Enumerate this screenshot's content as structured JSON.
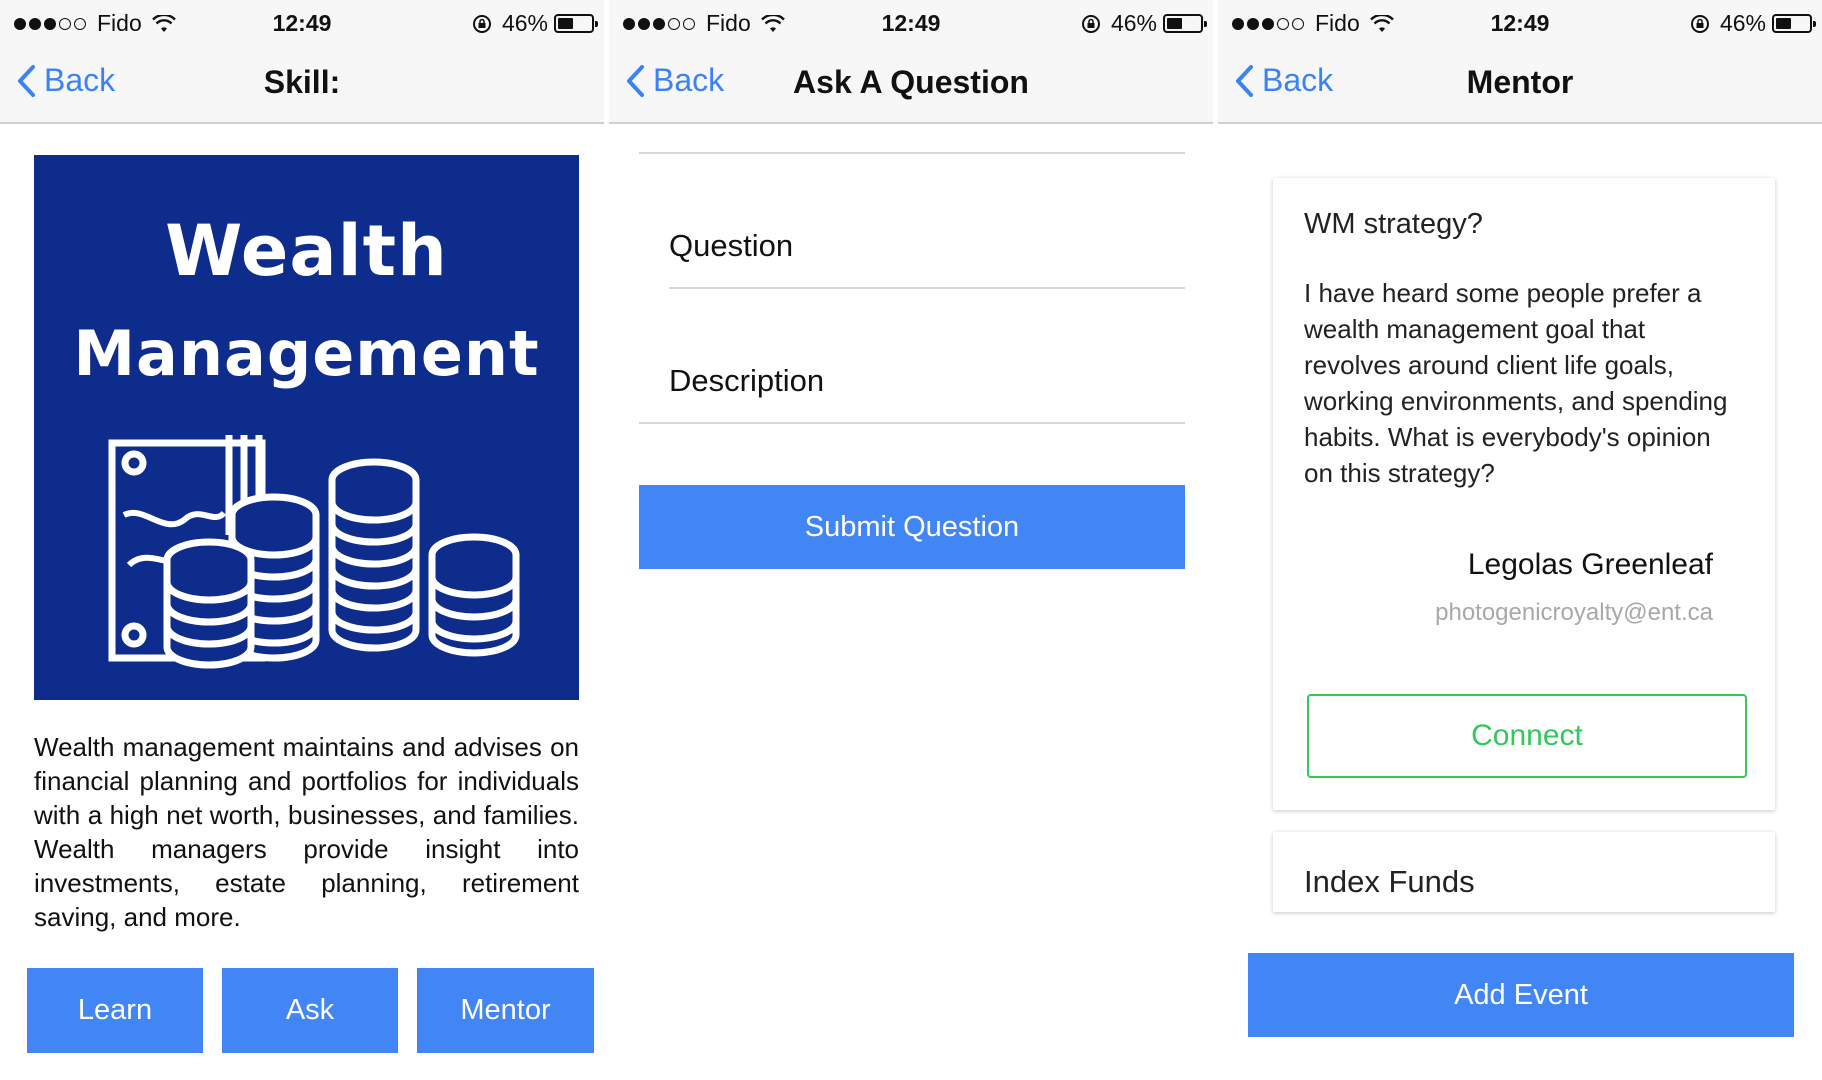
{
  "colors": {
    "accent": "#4285f4",
    "back_link": "#3b82f6",
    "connect_green": "#34c759",
    "image_bg": "#0d2c8c"
  },
  "statusbar": {
    "carrier": "Fido",
    "time": "12:49",
    "battery_pct": "46%",
    "battery_level": 0.46
  },
  "screens": [
    {
      "nav": {
        "back_label": "Back",
        "title": "Skill:"
      },
      "image": {
        "line1": "Wealth",
        "line2": "Management",
        "art_icon": "money-coins-icon"
      },
      "description": "Wealth management maintains and advises on financial planning and portfolios for individuals with a high net worth, businesses, and families. Wealth managers provide insight into investments, estate planning, retirement saving, and more.",
      "buttons": {
        "learn": "Learn",
        "ask": "Ask",
        "mentor": "Mentor"
      }
    },
    {
      "nav": {
        "back_label": "Back",
        "title": "Ask A Question"
      },
      "fields": {
        "question": "Question",
        "description": "Description"
      },
      "submit_label": "Submit Question"
    },
    {
      "nav": {
        "back_label": "Back",
        "title": "Mentor"
      },
      "cards": [
        {
          "title": "WM strategy?",
          "body": "I have heard some people prefer a wealth management goal that revolves around client life goals, working environments, and spending habits. What is everybody's opinion on this strategy?",
          "author": "Legolas Greenleaf",
          "email": "photogenicroyalty@ent.ca",
          "connect_label": "Connect"
        },
        {
          "title": "Index Funds"
        }
      ],
      "add_event_label": "Add Event"
    }
  ]
}
